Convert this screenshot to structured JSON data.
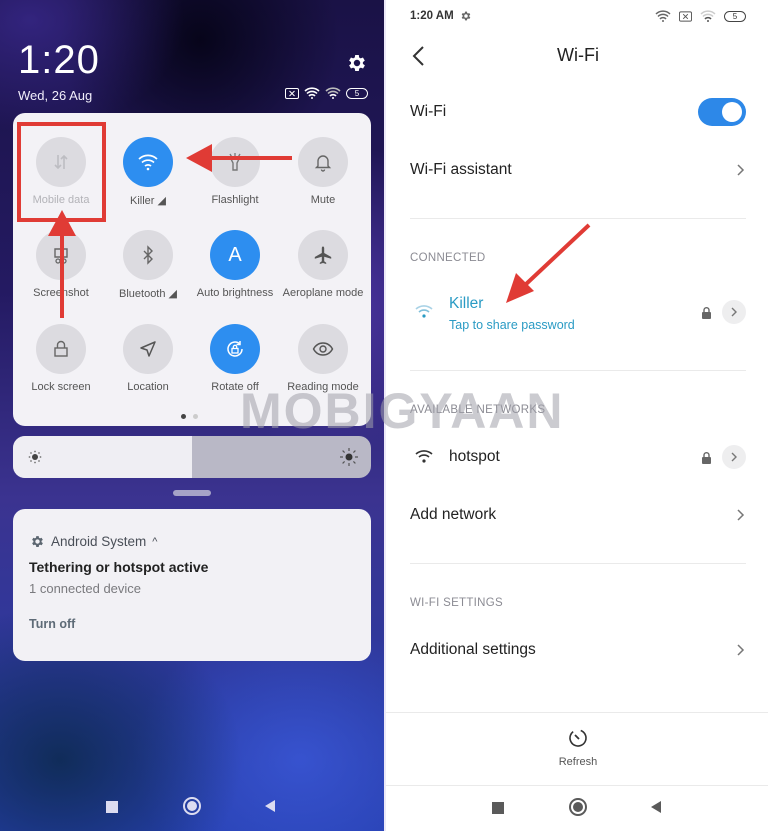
{
  "left": {
    "clock": "1:20",
    "date": "Wed, 26 Aug",
    "battery": "5",
    "tiles": [
      {
        "label": "Mobile data",
        "icon": "mobile-data-icon",
        "state": "off"
      },
      {
        "label": "Killer ◢",
        "icon": "wifi-icon",
        "state": "on"
      },
      {
        "label": "Flashlight",
        "icon": "flashlight-icon",
        "state": "off"
      },
      {
        "label": "Mute",
        "icon": "bell-icon",
        "state": "off"
      },
      {
        "label": "Screenshot",
        "icon": "screenshot-icon",
        "state": "off"
      },
      {
        "label": "Bluetooth ◢",
        "icon": "bluetooth-icon",
        "state": "off"
      },
      {
        "label": "Auto brightness",
        "icon": "auto-brightness-icon",
        "state": "on"
      },
      {
        "label": "Aeroplane mode",
        "icon": "airplane-icon",
        "state": "off"
      },
      {
        "label": "Lock screen",
        "icon": "lock-icon",
        "state": "off"
      },
      {
        "label": "Location",
        "icon": "location-icon",
        "state": "off"
      },
      {
        "label": "Rotate off",
        "icon": "rotate-lock-icon",
        "state": "on"
      },
      {
        "label": "Reading mode",
        "icon": "eye-icon",
        "state": "off"
      }
    ],
    "auto_brightness_glyph": "A",
    "pages": {
      "current": 1,
      "total": 2
    },
    "brightness_level": 0.5,
    "notification": {
      "app": "Android System",
      "expand_glyph": "^",
      "title": "Tethering or hotspot active",
      "text": "1 connected device",
      "action": "Turn off"
    }
  },
  "right": {
    "status_time": "1:20 AM",
    "battery": "5",
    "title": "Wi-Fi",
    "wifi_toggle_label": "Wi-Fi",
    "wifi_enabled": true,
    "wifi_assistant": "Wi-Fi assistant",
    "connected_header": "CONNECTED",
    "connected_network": {
      "name": "Killer",
      "sub": "Tap to share password",
      "secured": true
    },
    "available_header": "AVAILABLE NETWORKS",
    "available_networks": [
      {
        "name": "hotspot",
        "secured": true
      }
    ],
    "add_network": "Add network",
    "settings_header": "WI-FI SETTINGS",
    "additional_settings": "Additional settings",
    "refresh": "Refresh"
  },
  "watermark": "MOBIGYAAN",
  "colors": {
    "accent": "#2d8ef0",
    "connected": "#2a9bc4",
    "annotation": "#e03b35"
  }
}
